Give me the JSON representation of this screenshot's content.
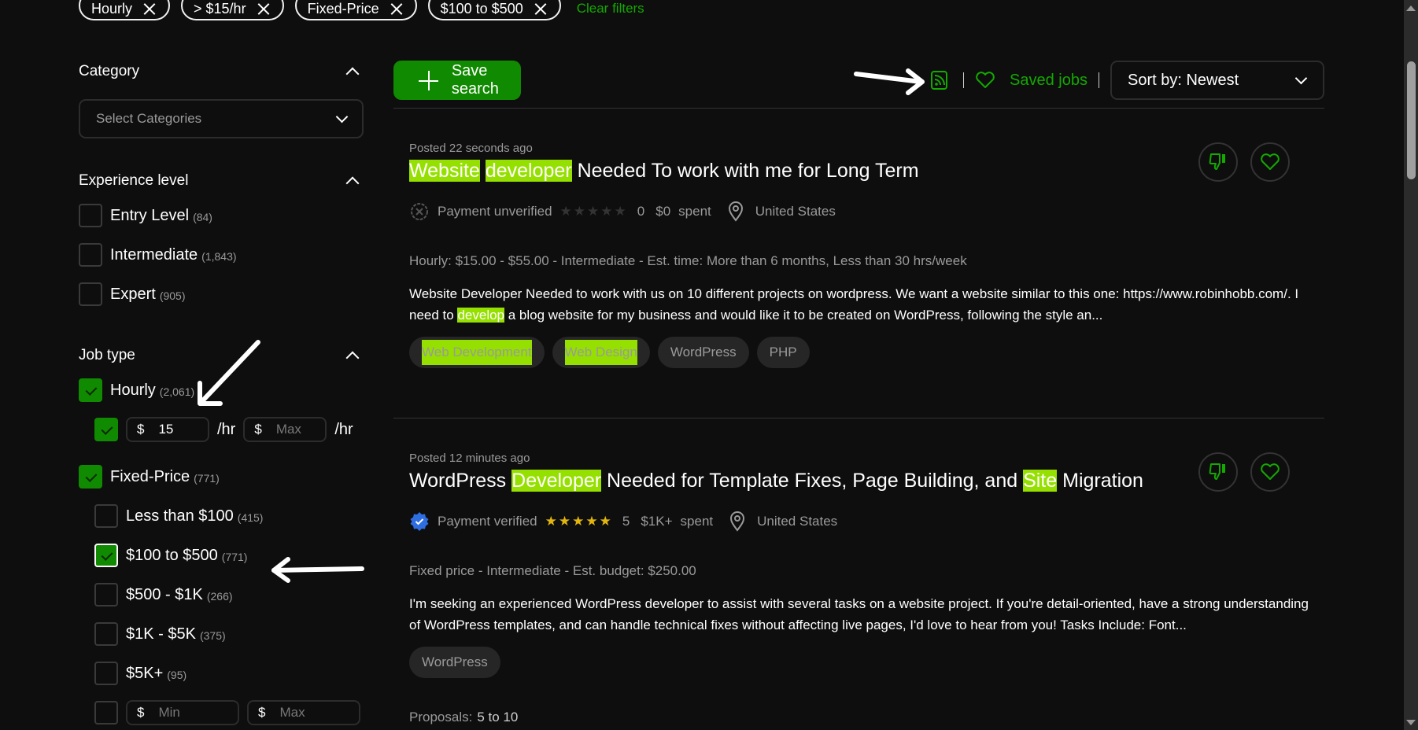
{
  "filter_chips": [
    {
      "label": "Hourly"
    },
    {
      "label": "> $15/hr"
    },
    {
      "label": "Fixed-Price"
    },
    {
      "label": "$100 to $500"
    }
  ],
  "clear_filters_label": "Clear filters",
  "sidebar": {
    "category": {
      "title": "Category",
      "select_placeholder": "Select Categories"
    },
    "experience": {
      "title": "Experience level",
      "options": [
        {
          "label": "Entry Level",
          "count": "(84)",
          "checked": false
        },
        {
          "label": "Intermediate",
          "count": "(1,843)",
          "checked": false
        },
        {
          "label": "Expert",
          "count": "(905)",
          "checked": false
        }
      ]
    },
    "job_type": {
      "title": "Job type",
      "hourly": {
        "label": "Hourly",
        "count": "(2,061)",
        "checked": true
      },
      "hourly_rate": {
        "currency": "$",
        "min_value": "15",
        "max_placeholder": "Max",
        "unit": "/hr"
      },
      "fixed": {
        "label": "Fixed-Price",
        "count": "(771)",
        "checked": true
      },
      "fixed_options": [
        {
          "label": "Less than $100",
          "count": "(415)",
          "checked": false
        },
        {
          "label": "$100 to $500",
          "count": "(771)",
          "checked": true
        },
        {
          "label": "$500 - $1K",
          "count": "(266)",
          "checked": false
        },
        {
          "label": "$1K - $5K",
          "count": "(375)",
          "checked": false
        },
        {
          "label": "$5K+",
          "count": "(95)",
          "checked": false
        }
      ],
      "fixed_custom": {
        "currency": "$",
        "min_placeholder": "Min",
        "max_placeholder": "Max"
      }
    }
  },
  "toolbar": {
    "save_search_label": "Save search",
    "saved_jobs_label": "Saved jobs",
    "sort_label": "Sort by: Newest"
  },
  "jobs": [
    {
      "posted": "Posted 22 seconds ago",
      "title_parts": [
        {
          "text": "Website",
          "hl": true
        },
        {
          "text": " ",
          "hl": false
        },
        {
          "text": "developer",
          "hl": true
        },
        {
          "text": " Needed To work with me for Long Term",
          "hl": false
        }
      ],
      "payment": "Payment unverified",
      "payment_verified": false,
      "rating": 0,
      "rating_label": "0",
      "spent": "$0",
      "spent_label": "spent",
      "location": "United States",
      "details": "Hourly: $15.00 - $55.00 - Intermediate - Est. time: More than 6 months, Less than 30 hrs/week",
      "desc_parts": [
        {
          "text": "Website Developer Needed to work with us on 10 different projects on wordpress. We want a website similar to this one: https://www.robinhobb.com/. I need to ",
          "hl": false
        },
        {
          "text": "develop",
          "hl": true
        },
        {
          "text": " a blog website for my business and would like it to be created on WordPress, following the style an...",
          "hl": false
        }
      ],
      "tags": [
        {
          "label": "Web Development",
          "hl": true
        },
        {
          "label": "Web Design",
          "hl": true
        },
        {
          "label": "WordPress",
          "hl": false
        },
        {
          "label": "PHP",
          "hl": false
        }
      ]
    },
    {
      "posted": "Posted 12 minutes ago",
      "title_parts": [
        {
          "text": "WordPress ",
          "hl": false
        },
        {
          "text": "Developer",
          "hl": true
        },
        {
          "text": " Needed for Template Fixes, Page Building, and ",
          "hl": false
        },
        {
          "text": "Site",
          "hl": true
        },
        {
          "text": " Migration",
          "hl": false
        }
      ],
      "payment": "Payment verified",
      "payment_verified": true,
      "rating": 5,
      "rating_label": "5",
      "spent": "$1K+",
      "spent_label": "spent",
      "location": "United States",
      "details": "Fixed price - Intermediate - Est. budget: $250.00",
      "desc_parts": [
        {
          "text": "I'm seeking an experienced WordPress developer to assist with several tasks on a website project. If you're detail-oriented, have a strong understanding of WordPress templates, and can handle technical fixes without affecting live pages, I'd love to hear from you! Tasks Include: Font...",
          "hl": false
        }
      ],
      "tags": [
        {
          "label": "WordPress",
          "hl": false
        }
      ],
      "proposals_label": "Proposals:",
      "proposals_value": "5 to 10"
    }
  ],
  "colors": {
    "accent": "#14a800",
    "button_green": "#108a00",
    "highlight": "#95e001",
    "star": "#e3b60f",
    "verified_badge": "#2f6ee0"
  }
}
